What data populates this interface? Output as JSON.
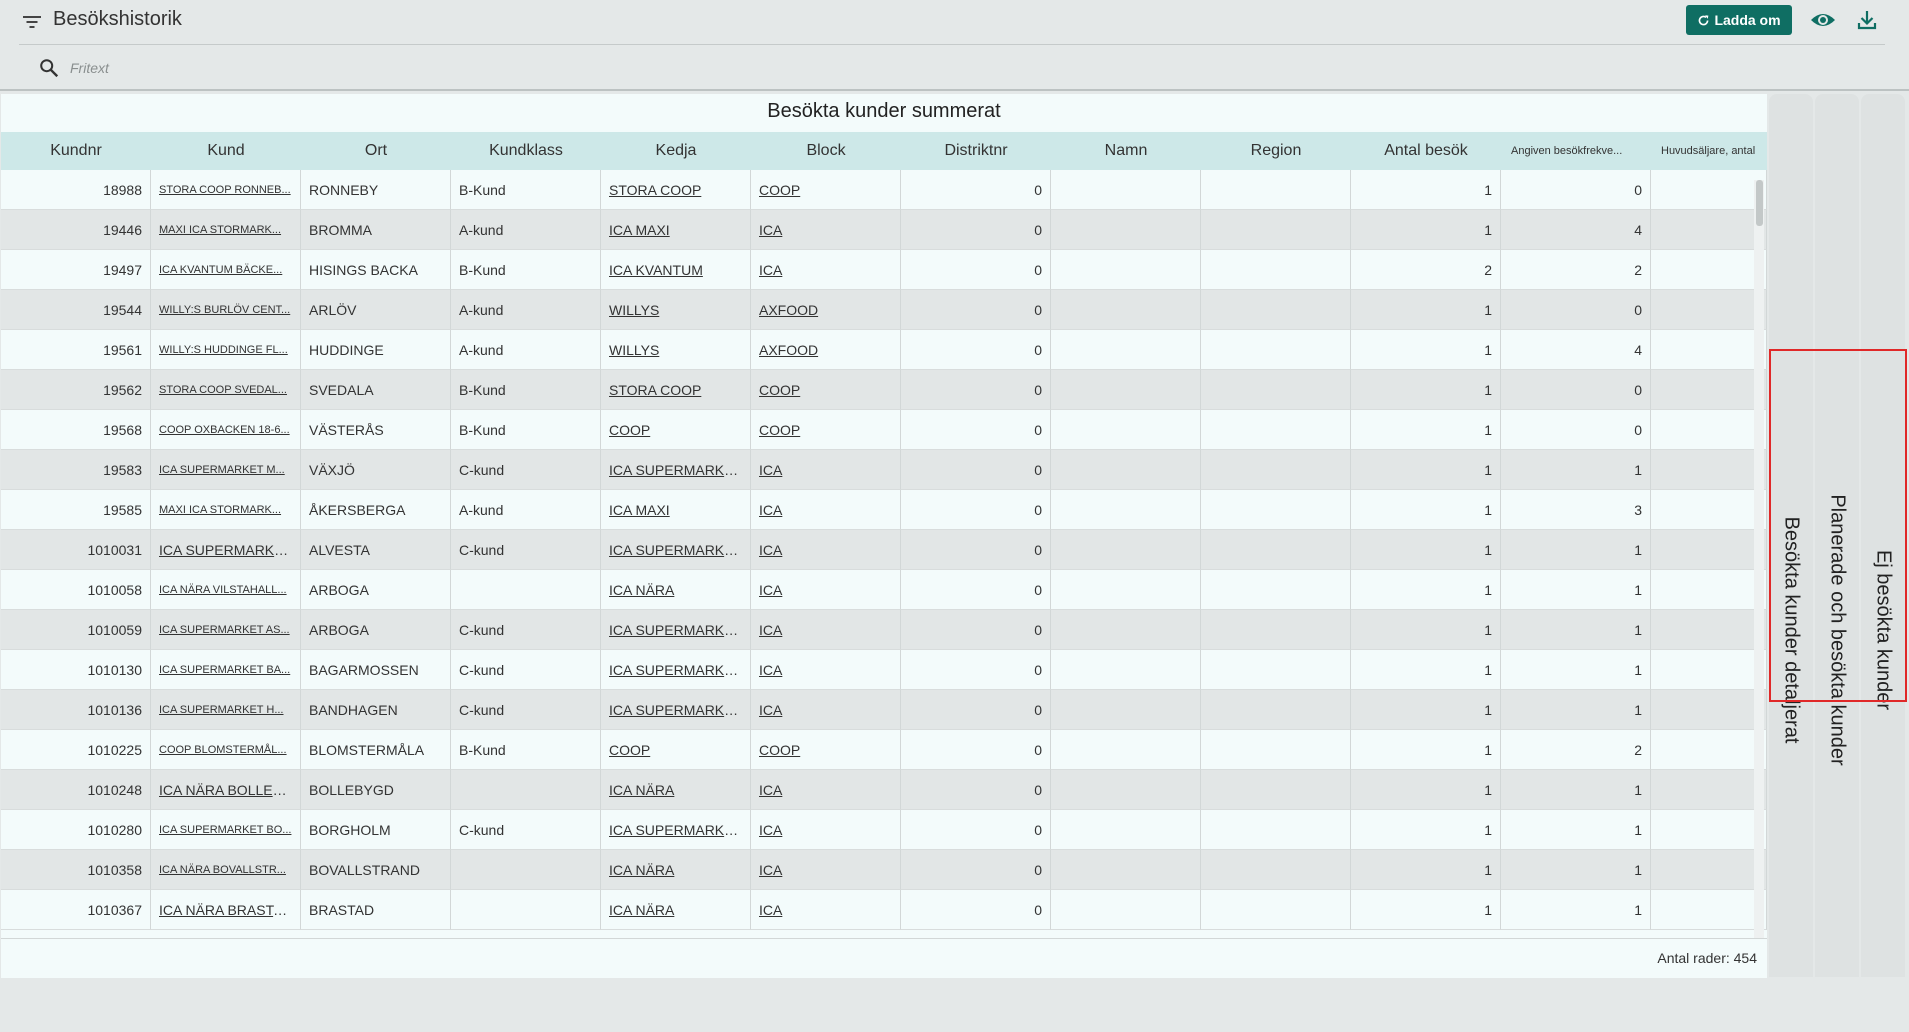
{
  "header": {
    "title": "Besökshistorik",
    "reload_label": "Ladda om"
  },
  "search": {
    "placeholder": "Fritext",
    "value": ""
  },
  "grid": {
    "title": "Besökta kunder summerat",
    "columns": [
      "Kundnr",
      "Kund",
      "Ort",
      "Kundklass",
      "Kedja",
      "Block",
      "Distriktnr",
      "Namn",
      "Region",
      "Antal besök",
      "Angiven besökfrekve...",
      "Huvudsäljare, antal"
    ],
    "rows": [
      [
        "18988",
        "STORA COOP RONNEB...",
        "RONNEBY",
        "B-Kund",
        "STORA COOP",
        "COOP",
        "0",
        "",
        "",
        "1",
        "0",
        ""
      ],
      [
        "19446",
        "MAXI ICA STORMARK...",
        "BROMMA",
        "A-kund",
        "ICA MAXI",
        "ICA",
        "0",
        "",
        "",
        "1",
        "4",
        ""
      ],
      [
        "19497",
        "ICA KVANTUM BÄCKE...",
        "HISINGS BACKA",
        "B-Kund",
        "ICA KVANTUM",
        "ICA",
        "0",
        "",
        "",
        "2",
        "2",
        ""
      ],
      [
        "19544",
        "WILLY:S BURLÖV CENT...",
        "ARLÖV",
        "A-kund",
        "WILLYS",
        "AXFOOD",
        "0",
        "",
        "",
        "1",
        "0",
        ""
      ],
      [
        "19561",
        "WILLY:S HUDDINGE FL...",
        "HUDDINGE",
        "A-kund",
        "WILLYS",
        "AXFOOD",
        "0",
        "",
        "",
        "1",
        "4",
        ""
      ],
      [
        "19562",
        "STORA COOP SVEDAL...",
        "SVEDALA",
        "B-Kund",
        "STORA COOP",
        "COOP",
        "0",
        "",
        "",
        "1",
        "0",
        ""
      ],
      [
        "19568",
        "COOP OXBACKEN 18-6...",
        "VÄSTERÅS",
        "B-Kund",
        "COOP",
        "COOP",
        "0",
        "",
        "",
        "1",
        "0",
        ""
      ],
      [
        "19583",
        "ICA SUPERMARKET M...",
        "VÄXJÖ",
        "C-kund",
        "ICA SUPERMARKET",
        "ICA",
        "0",
        "",
        "",
        "1",
        "1",
        ""
      ],
      [
        "19585",
        "MAXI ICA STORMARK...",
        "ÅKERSBERGA",
        "A-kund",
        "ICA MAXI",
        "ICA",
        "0",
        "",
        "",
        "1",
        "3",
        ""
      ],
      [
        "1010031",
        "ICA SUPERMARKET",
        "ALVESTA",
        "C-kund",
        "ICA SUPERMARKET",
        "ICA",
        "0",
        "",
        "",
        "1",
        "1",
        ""
      ],
      [
        "1010058",
        "ICA NÄRA VILSTAHALL...",
        "ARBOGA",
        "",
        "ICA NÄRA",
        "ICA",
        "0",
        "",
        "",
        "1",
        "1",
        ""
      ],
      [
        "1010059",
        "ICA SUPERMARKET AS...",
        "ARBOGA",
        "C-kund",
        "ICA SUPERMARKET",
        "ICA",
        "0",
        "",
        "",
        "1",
        "1",
        ""
      ],
      [
        "1010130",
        "ICA SUPERMARKET BA...",
        "BAGARMOSSEN",
        "C-kund",
        "ICA SUPERMARKET",
        "ICA",
        "0",
        "",
        "",
        "1",
        "1",
        ""
      ],
      [
        "1010136",
        "ICA SUPERMARKET H...",
        "BANDHAGEN",
        "C-kund",
        "ICA SUPERMARKET",
        "ICA",
        "0",
        "",
        "",
        "1",
        "1",
        ""
      ],
      [
        "1010225",
        "COOP BLOMSTERMÅL...",
        "BLOMSTERMÅLA",
        "B-Kund",
        "COOP",
        "COOP",
        "0",
        "",
        "",
        "1",
        "2",
        ""
      ],
      [
        "1010248",
        "ICA NÄRA BOLLEBYGD",
        "BOLLEBYGD",
        "",
        "ICA NÄRA",
        "ICA",
        "0",
        "",
        "",
        "1",
        "1",
        ""
      ],
      [
        "1010280",
        "ICA SUPERMARKET BO...",
        "BORGHOLM",
        "C-kund",
        "ICA SUPERMARKET",
        "ICA",
        "0",
        "",
        "",
        "1",
        "1",
        ""
      ],
      [
        "1010358",
        "ICA NÄRA BOVALLSTR...",
        "BOVALLSTRAND",
        "",
        "ICA NÄRA",
        "ICA",
        "0",
        "",
        "",
        "1",
        "1",
        ""
      ],
      [
        "1010367",
        "ICA NÄRA BRASTAD",
        "BRASTAD",
        "",
        "ICA NÄRA",
        "ICA",
        "0",
        "",
        "",
        "1",
        "1",
        ""
      ]
    ],
    "footer": "Antal rader: 454"
  },
  "side_tabs": [
    "Besökta kunder detaljerat",
    "Planerade och besökta kunder",
    "Ej besökta kunder"
  ],
  "colors": {
    "accent": "#0f6e63",
    "header_bg": "#cde8e8",
    "highlight": "#e02828"
  }
}
